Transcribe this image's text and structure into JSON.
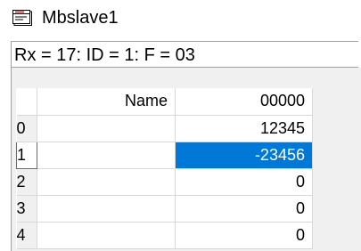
{
  "window": {
    "title": "Mbslave1",
    "icon": "document-window-icon"
  },
  "status": {
    "text": "Rx = 17: ID = 1: F = 03"
  },
  "grid": {
    "columns": [
      "Name",
      "00000"
    ],
    "rows": [
      {
        "index": "0",
        "name": "",
        "value": "12345"
      },
      {
        "index": "1",
        "name": "",
        "value": "-23456"
      },
      {
        "index": "2",
        "name": "",
        "value": "0"
      },
      {
        "index": "3",
        "name": "",
        "value": "0"
      },
      {
        "index": "4",
        "name": "",
        "value": "0"
      }
    ],
    "selected_row": 1,
    "selection_color": "#0078d7"
  }
}
